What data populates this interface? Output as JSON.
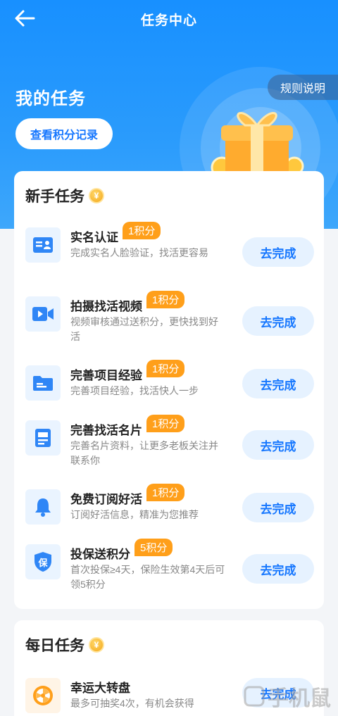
{
  "nav": {
    "title": "任务中心"
  },
  "hero": {
    "title": "我的任务",
    "points_button": "查看积分记录",
    "rules_button": "规则说明"
  },
  "newbie": {
    "title": "新手任务",
    "coin_symbol": "¥",
    "tasks": [
      {
        "name": "实名认证",
        "points": "1积分",
        "desc": "完成实名人脸验证，找活更容易",
        "button": "去完成",
        "icon": "id-card-icon"
      },
      {
        "name": "拍摄找活视频",
        "points": "1积分",
        "desc": "视频审核通过送积分，更快找到好活",
        "button": "去完成",
        "icon": "video-icon"
      },
      {
        "name": "完善项目经验",
        "points": "1积分",
        "desc": "完善项目经验，找活快人一步",
        "button": "去完成",
        "icon": "folder-icon"
      },
      {
        "name": "完善找活名片",
        "points": "1积分",
        "desc": "完善名片资料，让更多老板关注并联系你",
        "button": "去完成",
        "icon": "document-icon"
      },
      {
        "name": "免费订阅好活",
        "points": "1积分",
        "desc": "订阅好活信息，精准为您推荐",
        "button": "去完成",
        "icon": "bell-icon"
      },
      {
        "name": "投保送积分",
        "points": "5积分",
        "desc": "首次投保≥4天，保险生效第4天后可领5积分",
        "button": "去完成",
        "icon": "shield-icon",
        "icon_text": "保"
      }
    ]
  },
  "daily": {
    "title": "每日任务",
    "coin_symbol": "¥",
    "tasks": [
      {
        "name": "幸运大转盘",
        "desc": "最多可抽奖4次，有机会获得",
        "button": "去完成",
        "icon": "wheel-icon"
      }
    ]
  },
  "watermark": "手机鼠",
  "colors": {
    "primary": "#1677ff",
    "badge": "#ff9f1a",
    "hero": "#1890ff"
  }
}
